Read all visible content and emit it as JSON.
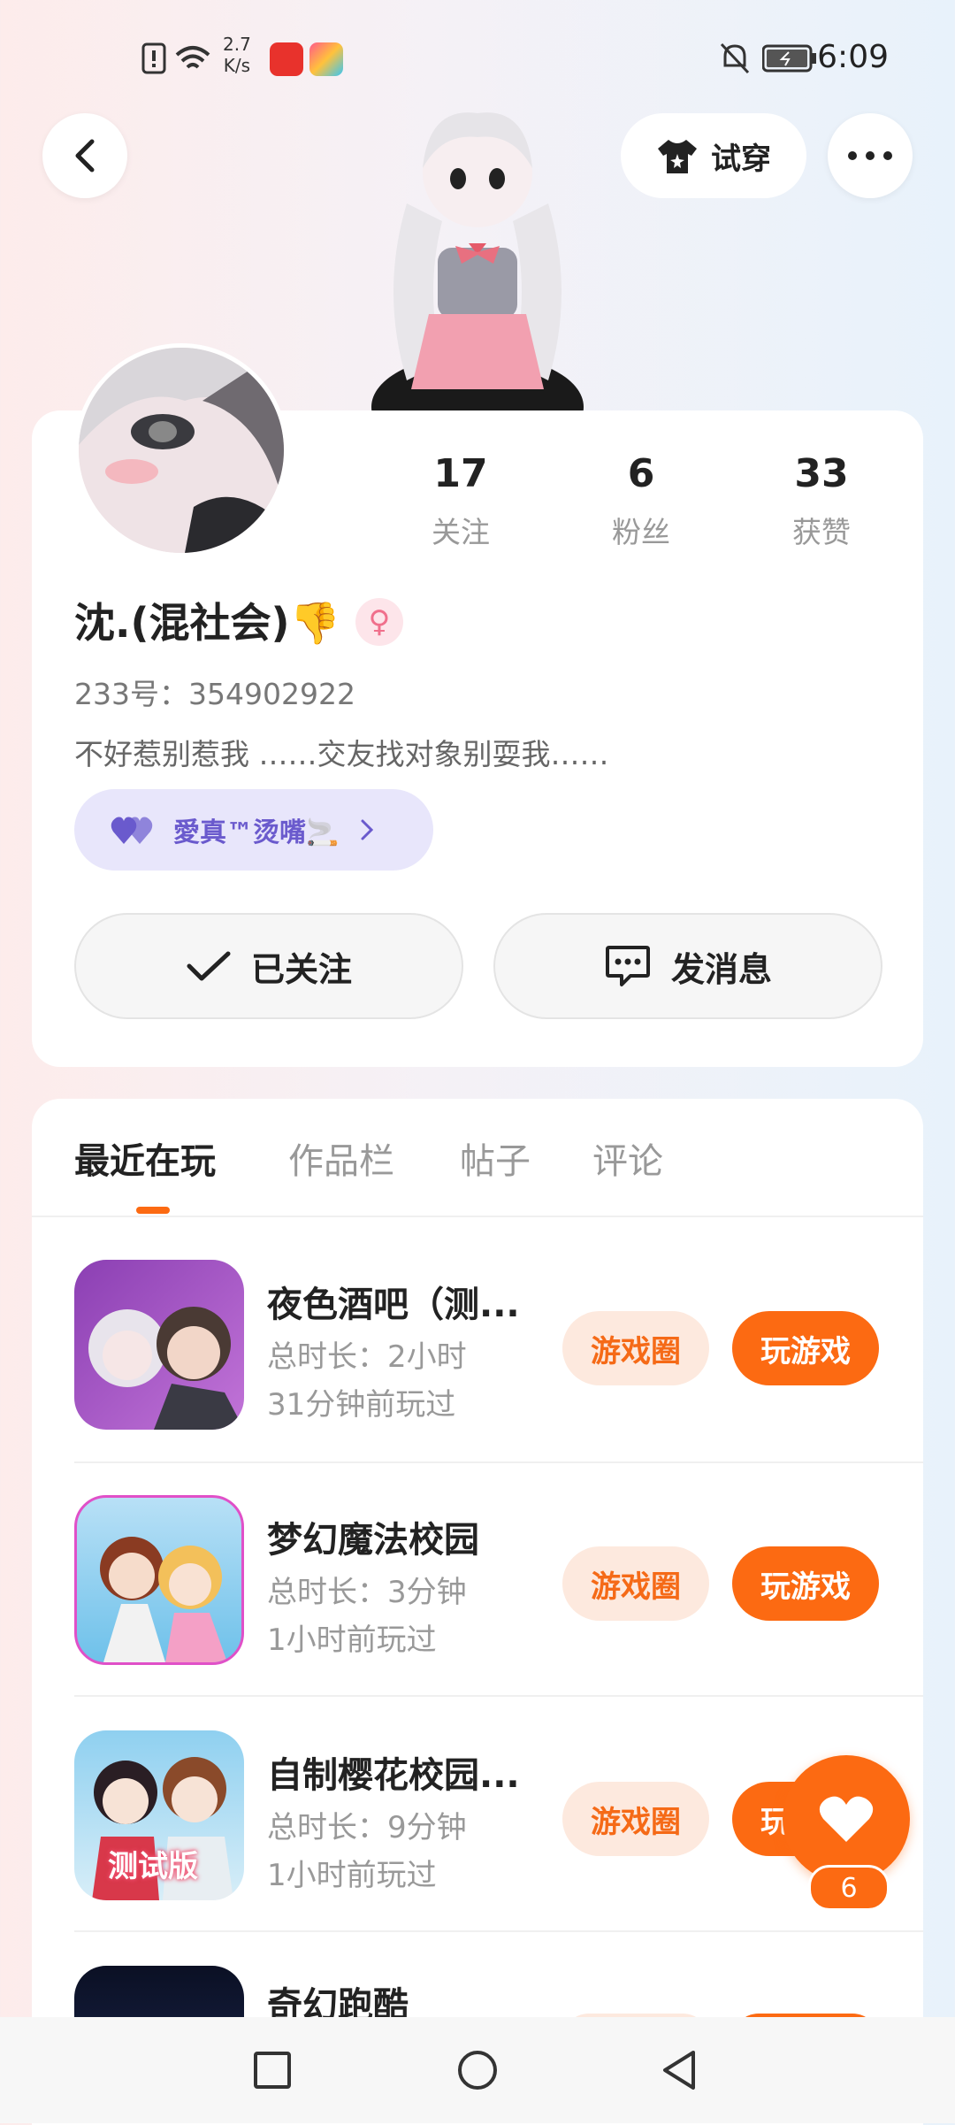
{
  "status_bar": {
    "net_speed_value": "2.7",
    "net_speed_unit": "K/s",
    "time": "6:09"
  },
  "top": {
    "try_on_label": "试穿"
  },
  "profile": {
    "stats": [
      {
        "value": "17",
        "label": "关注"
      },
      {
        "value": "6",
        "label": "粉丝"
      },
      {
        "value": "33",
        "label": "获赞"
      }
    ],
    "name": "沈.(混社会)👎",
    "gender_symbol": "♀",
    "id_line": "233号：354902922",
    "bio": "不好惹别惹我 ……交友找对象别耍我……",
    "badge_text": "愛真™烫嘴🚬",
    "follow_label": "已关注",
    "message_label": "发消息"
  },
  "tabs": [
    {
      "label": "最近在玩",
      "active": true
    },
    {
      "label": "作品栏",
      "active": false
    },
    {
      "label": "帖子",
      "active": false
    },
    {
      "label": "评论",
      "active": false
    }
  ],
  "games": [
    {
      "title": "夜色酒吧（测...",
      "duration": "总时长：2小时",
      "last_played": "31分钟前玩过"
    },
    {
      "title": "梦幻魔法校园",
      "duration": "总时长：3分钟",
      "last_played": "1小时前玩过"
    },
    {
      "title": "自制樱花校园...",
      "duration": "总时长：9分钟",
      "last_played": "1小时前玩过",
      "thumb_text": "测试版"
    },
    {
      "title": "奇幻跑酷",
      "duration": "",
      "last_played": ""
    }
  ],
  "buttons": {
    "circle_label": "游戏圈",
    "play_label": "玩游戏"
  },
  "like_fab": {
    "count": "6"
  },
  "colors": {
    "accent": "#fc6a12",
    "accent_soft": "#fde9de",
    "badge_bg": "#e8e6fb",
    "badge_text": "#6a5acd",
    "gender_pink": "#f0708c"
  }
}
